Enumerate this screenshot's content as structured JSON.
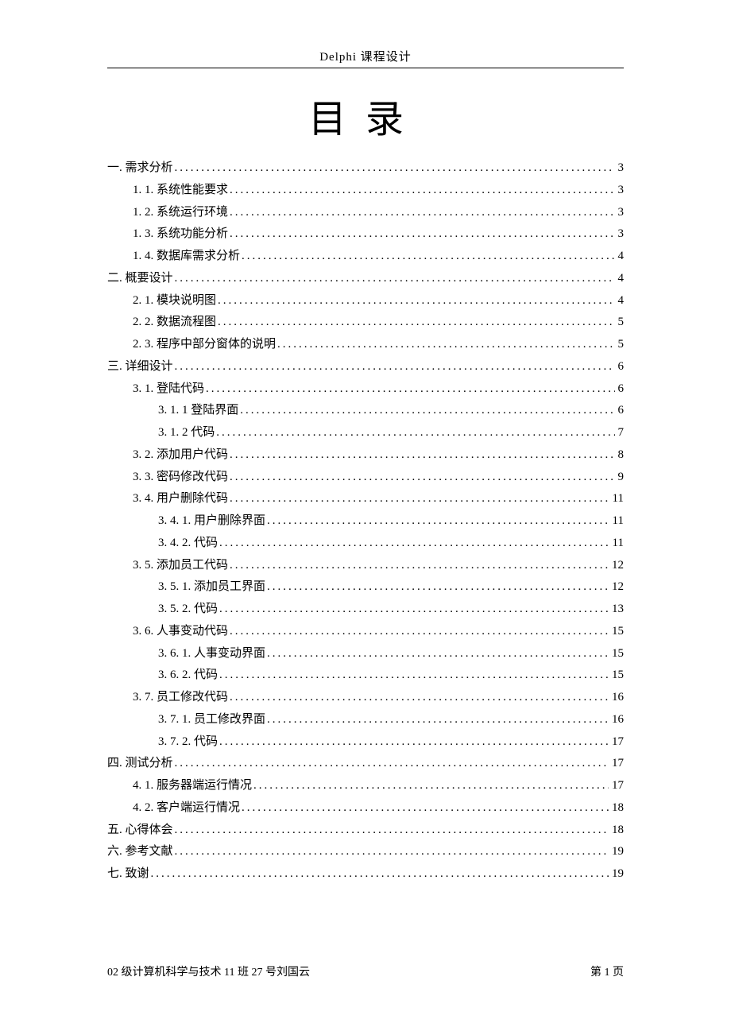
{
  "header": "Delphi 课程设计",
  "title": "目录",
  "toc": [
    {
      "level": 0,
      "label": "一. 需求分析",
      "page": "3"
    },
    {
      "level": 1,
      "label": "1. 1. 系统性能要求",
      "page": "3"
    },
    {
      "level": 1,
      "label": "1. 2. 系统运行环境",
      "page": "3"
    },
    {
      "level": 1,
      "label": "1. 3. 系统功能分析",
      "page": "3"
    },
    {
      "level": 1,
      "label": "1. 4. 数据库需求分析",
      "page": "4"
    },
    {
      "level": 0,
      "label": "二. 概要设计",
      "page": "4"
    },
    {
      "level": 1,
      "label": "2. 1. 模块说明图",
      "page": "4"
    },
    {
      "level": 1,
      "label": "2. 2. 数据流程图",
      "page": "5"
    },
    {
      "level": 1,
      "label": "2. 3. 程序中部分窗体的说明",
      "page": "5"
    },
    {
      "level": 0,
      "label": "三. 详细设计",
      "page": "6"
    },
    {
      "level": 1,
      "label": "3. 1. 登陆代码",
      "page": "6"
    },
    {
      "level": 2,
      "label": "3. 1. 1 登陆界面",
      "page": "6"
    },
    {
      "level": 2,
      "label": "3. 1. 2 代码",
      "page": "7"
    },
    {
      "level": 1,
      "label": "3. 2.  添加用户代码",
      "page": "8"
    },
    {
      "level": 1,
      "label": "3. 3.  密码修改代码",
      "page": "9"
    },
    {
      "level": 1,
      "label": "3. 4.  用户删除代码",
      "page": "11"
    },
    {
      "level": 2,
      "label": "3. 4. 1. 用户删除界面",
      "page": "11"
    },
    {
      "level": 2,
      "label": "3. 4. 2. 代码",
      "page": "11"
    },
    {
      "level": 1,
      "label": "3. 5.  添加员工代码",
      "page": "12"
    },
    {
      "level": 2,
      "label": "3. 5. 1. 添加员工界面",
      "page": "12"
    },
    {
      "level": 2,
      "label": "3. 5. 2. 代码",
      "page": "13"
    },
    {
      "level": 1,
      "label": "3. 6. 人事变动代码",
      "page": "15"
    },
    {
      "level": 2,
      "label": "3. 6. 1. 人事变动界面",
      "page": "15"
    },
    {
      "level": 2,
      "label": "3. 6. 2. 代码",
      "page": "15"
    },
    {
      "level": 1,
      "label": "3. 7. 员工修改代码",
      "page": "16"
    },
    {
      "level": 2,
      "label": "3. 7. 1. 员工修改界面",
      "page": "16"
    },
    {
      "level": 2,
      "label": "3. 7. 2. 代码",
      "page": "17"
    },
    {
      "level": 0,
      "label": "四. 测试分析",
      "page": "17"
    },
    {
      "level": 1,
      "label": "4. 1. 服务器端运行情况",
      "page": "17"
    },
    {
      "level": 1,
      "label": "4. 2. 客户端运行情况",
      "page": "18"
    },
    {
      "level": 0,
      "label": "五. 心得体会",
      "page": "18"
    },
    {
      "level": 0,
      "label": "六. 参考文献",
      "page": "19"
    },
    {
      "level": 0,
      "label": "七. 致谢",
      "page": "19"
    }
  ],
  "footer": {
    "left": "02 级计算机科学与技术 11 班 27 号刘国云",
    "right": "第 1 页"
  }
}
